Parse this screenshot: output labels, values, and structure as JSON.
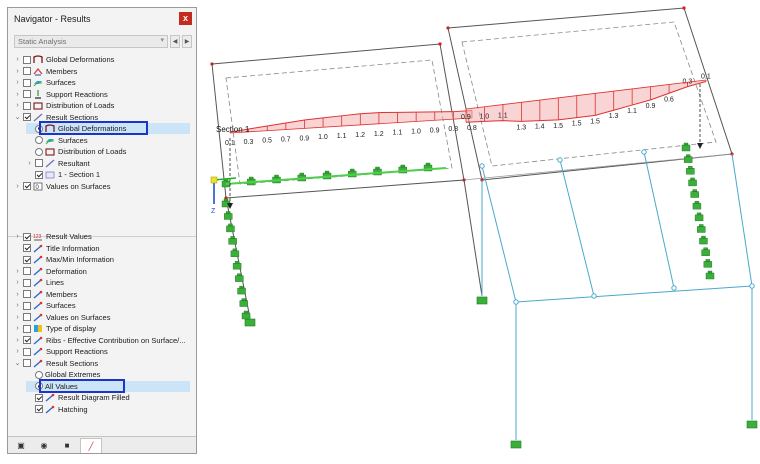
{
  "navigator": {
    "title": "Navigator - Results",
    "close_label": "x",
    "combo_value": "Static Analysis",
    "results_tree": [
      {
        "label": "Global Deformations",
        "expander": "›",
        "control": "checkbox",
        "checked": false,
        "icon": "deformation-icon",
        "indent": 0
      },
      {
        "label": "Members",
        "expander": "›",
        "control": "checkbox",
        "checked": false,
        "icon": "members-icon",
        "indent": 0
      },
      {
        "label": "Surfaces",
        "expander": "›",
        "control": "checkbox",
        "checked": false,
        "icon": "surfaces-icon",
        "indent": 0
      },
      {
        "label": "Support Reactions",
        "expander": "›",
        "control": "checkbox",
        "checked": false,
        "icon": "support-reactions-icon",
        "indent": 0
      },
      {
        "label": "Distribution of Loads",
        "expander": "›",
        "control": "checkbox",
        "checked": false,
        "icon": "distribution-icon",
        "indent": 0
      },
      {
        "label": "Result Sections",
        "expander": "⌄",
        "control": "checkbox",
        "checked": true,
        "icon": "result-sections-icon",
        "indent": 0
      },
      {
        "label": "Global Deformations",
        "expander": "",
        "control": "radio",
        "checked": true,
        "icon": "deformation-icon",
        "indent": 1,
        "selected": true
      },
      {
        "label": "Surfaces",
        "expander": "",
        "control": "radio",
        "checked": false,
        "icon": "surfaces-icon",
        "indent": 1
      },
      {
        "label": "Distribution of Loads",
        "expander": "",
        "control": "radio",
        "checked": false,
        "icon": "distribution-icon",
        "indent": 1
      },
      {
        "label": "Resultant",
        "expander": "›",
        "control": "checkbox",
        "checked": false,
        "icon": "resultant-icon",
        "indent": 1
      },
      {
        "label": "1 - Section 1",
        "expander": "",
        "control": "checkbox",
        "checked": true,
        "icon": "section-icon",
        "indent": 1
      },
      {
        "label": "Values on Surfaces",
        "expander": "›",
        "control": "checkbox",
        "checked": true,
        "icon": "values-on-surfaces-icon",
        "indent": 0
      }
    ],
    "display_tree": [
      {
        "label": "Result Values",
        "expander": "›",
        "control": "checkbox",
        "checked": true,
        "icon": "result-values-icon",
        "indent": 0
      },
      {
        "label": "Title Information",
        "expander": "",
        "control": "checkbox",
        "checked": true,
        "icon": "wand-icon",
        "indent": 0
      },
      {
        "label": "Max/Min Information",
        "expander": "",
        "control": "checkbox",
        "checked": true,
        "icon": "wand-icon",
        "indent": 0
      },
      {
        "label": "Deformation",
        "expander": "›",
        "control": "checkbox",
        "checked": false,
        "icon": "wand-icon",
        "indent": 0
      },
      {
        "label": "Lines",
        "expander": "›",
        "control": "checkbox",
        "checked": false,
        "icon": "wand-icon",
        "indent": 0
      },
      {
        "label": "Members",
        "expander": "›",
        "control": "checkbox",
        "checked": false,
        "icon": "wand-icon",
        "indent": 0
      },
      {
        "label": "Surfaces",
        "expander": "›",
        "control": "checkbox",
        "checked": false,
        "icon": "wand-icon",
        "indent": 0
      },
      {
        "label": "Values on Surfaces",
        "expander": "›",
        "control": "checkbox",
        "checked": false,
        "icon": "wand-icon",
        "indent": 0
      },
      {
        "label": "Type of display",
        "expander": "›",
        "control": "checkbox",
        "checked": false,
        "icon": "type-of-display-icon",
        "indent": 0
      },
      {
        "label": "Ribs - Effective Contribution on Surface/...",
        "expander": "›",
        "control": "checkbox",
        "checked": true,
        "icon": "wand-icon",
        "indent": 0
      },
      {
        "label": "Support Reactions",
        "expander": "›",
        "control": "checkbox",
        "checked": false,
        "icon": "wand-icon",
        "indent": 0
      },
      {
        "label": "Result Sections",
        "expander": "⌄",
        "control": "checkbox",
        "checked": false,
        "icon": "wand-icon",
        "indent": 0
      },
      {
        "label": "Global Extremes",
        "expander": "",
        "control": "radio",
        "checked": false,
        "icon": "",
        "indent": 1
      },
      {
        "label": "All Values",
        "expander": "",
        "control": "radio",
        "checked": true,
        "icon": "",
        "indent": 1,
        "selected": true
      },
      {
        "label": "Result Diagram Filled",
        "expander": "",
        "control": "checkbox",
        "checked": true,
        "icon": "wand-icon",
        "indent": 1
      },
      {
        "label": "Hatching",
        "expander": "",
        "control": "checkbox",
        "checked": true,
        "icon": "wand-icon",
        "indent": 1
      }
    ],
    "tabs": [
      {
        "icon": "data-tab-icon",
        "active": false
      },
      {
        "icon": "display-tab-icon",
        "active": false
      },
      {
        "icon": "views-tab-icon",
        "active": false
      },
      {
        "icon": "results-tab-icon",
        "active": true
      }
    ]
  },
  "viewport": {
    "section_label": "Section 1",
    "axis_z_label": "Z",
    "left_diagram_values": [
      "0.1",
      "0.3",
      "0.5",
      "0.7",
      "0.9",
      "1.0",
      "1.1",
      "1.2",
      "1.2",
      "1.1",
      "1.0",
      "0.9",
      "0.8",
      "0.8"
    ],
    "right_diagram_values": [
      "0.9",
      "1.0",
      "1.1",
      "1.3",
      "1.4",
      "1.5",
      "1.5",
      "1.5",
      "1.3",
      "1.1",
      "0.9",
      "0.6",
      "0.3",
      "0.1"
    ],
    "colors": {
      "diagram": "#e03030",
      "hatch": "#f2b0b0",
      "frame": "#555555",
      "member": "#4aa8cc",
      "support": "#3ab03a"
    }
  }
}
